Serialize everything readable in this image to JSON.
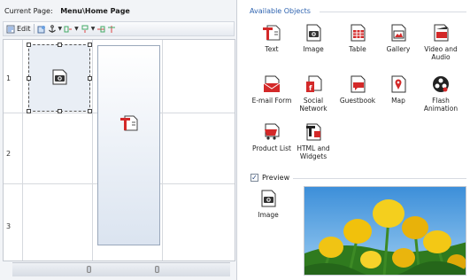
{
  "current_page": {
    "label": "Current Page:",
    "value": "Menu\\Home Page"
  },
  "toolbar": {
    "edit_label": "Edit"
  },
  "grid": {
    "row_numbers": [
      "1",
      "2",
      "3"
    ]
  },
  "available_objects": {
    "title": "Available Objects",
    "items": [
      {
        "label": "Text",
        "icon": "text-icon"
      },
      {
        "label": "Image",
        "icon": "image-icon"
      },
      {
        "label": "Table",
        "icon": "table-icon"
      },
      {
        "label": "Gallery",
        "icon": "gallery-icon"
      },
      {
        "label": "Video and Audio",
        "icon": "video-icon"
      },
      {
        "label": "E-mail Form",
        "icon": "email-icon"
      },
      {
        "label": "Social Network",
        "icon": "social-icon"
      },
      {
        "label": "Guestbook",
        "icon": "guestbook-icon"
      },
      {
        "label": "Map",
        "icon": "map-icon"
      },
      {
        "label": "Flash Animation",
        "icon": "flash-icon"
      },
      {
        "label": "Product List",
        "icon": "product-icon"
      },
      {
        "label": "HTML and Widgets",
        "icon": "html-icon"
      }
    ]
  },
  "preview": {
    "checkbox_label": "Preview",
    "checked": true,
    "item_label": "Image"
  },
  "colors": {
    "accent": "#2f64b0",
    "icon_red": "#d32929"
  }
}
